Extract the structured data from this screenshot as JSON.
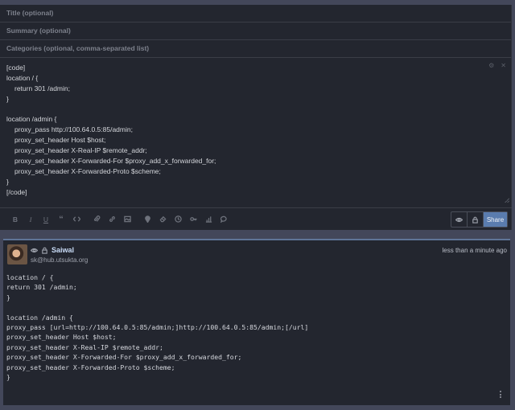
{
  "composer": {
    "title_placeholder": "Title (optional)",
    "summary_placeholder": "Summary (optional)",
    "categories_placeholder": "Categories (optional, comma-separated list)",
    "body_lines": [
      "[code]",
      "location / {",
      "return 301 /admin;",
      "}",
      "",
      "location /admin {",
      "proxy_pass http://100.64.0.5:85/admin;",
      "proxy_set_header Host $host;",
      "proxy_set_header X-Real-IP $remote_addr;",
      "proxy_set_header X-Forwarded-For $proxy_add_x_forwarded_for;",
      "proxy_set_header X-Forwarded-Proto $scheme;",
      "}",
      "[/code]"
    ],
    "share_label": "Share"
  },
  "toolbar_icons": [
    "bold-icon",
    "italic-icon",
    "underline-icon",
    "quote-icon",
    "code-icon",
    "attachment-icon",
    "link-icon",
    "image-icon",
    "location-icon",
    "eraser-icon",
    "clock-icon",
    "key-icon",
    "chart-icon",
    "comment-icon"
  ],
  "post": {
    "author": "Saiwal",
    "handle": "sk@hub.utsukta.org",
    "time": "less than a minute ago",
    "body_lines": [
      "location / {",
      "return 301 /admin;",
      "}",
      "",
      "location /admin {",
      "proxy_pass [url=http://100.64.0.5:85/admin;]http://100.64.0.5:85/admin;[/url]",
      "proxy_set_header Host $host;",
      "proxy_set_header X-Real-IP $remote_addr;",
      "proxy_set_header X-Forwarded-For $proxy_add_x_forwarded_for;",
      "proxy_set_header X-Forwarded-Proto $scheme;",
      "}"
    ]
  }
}
